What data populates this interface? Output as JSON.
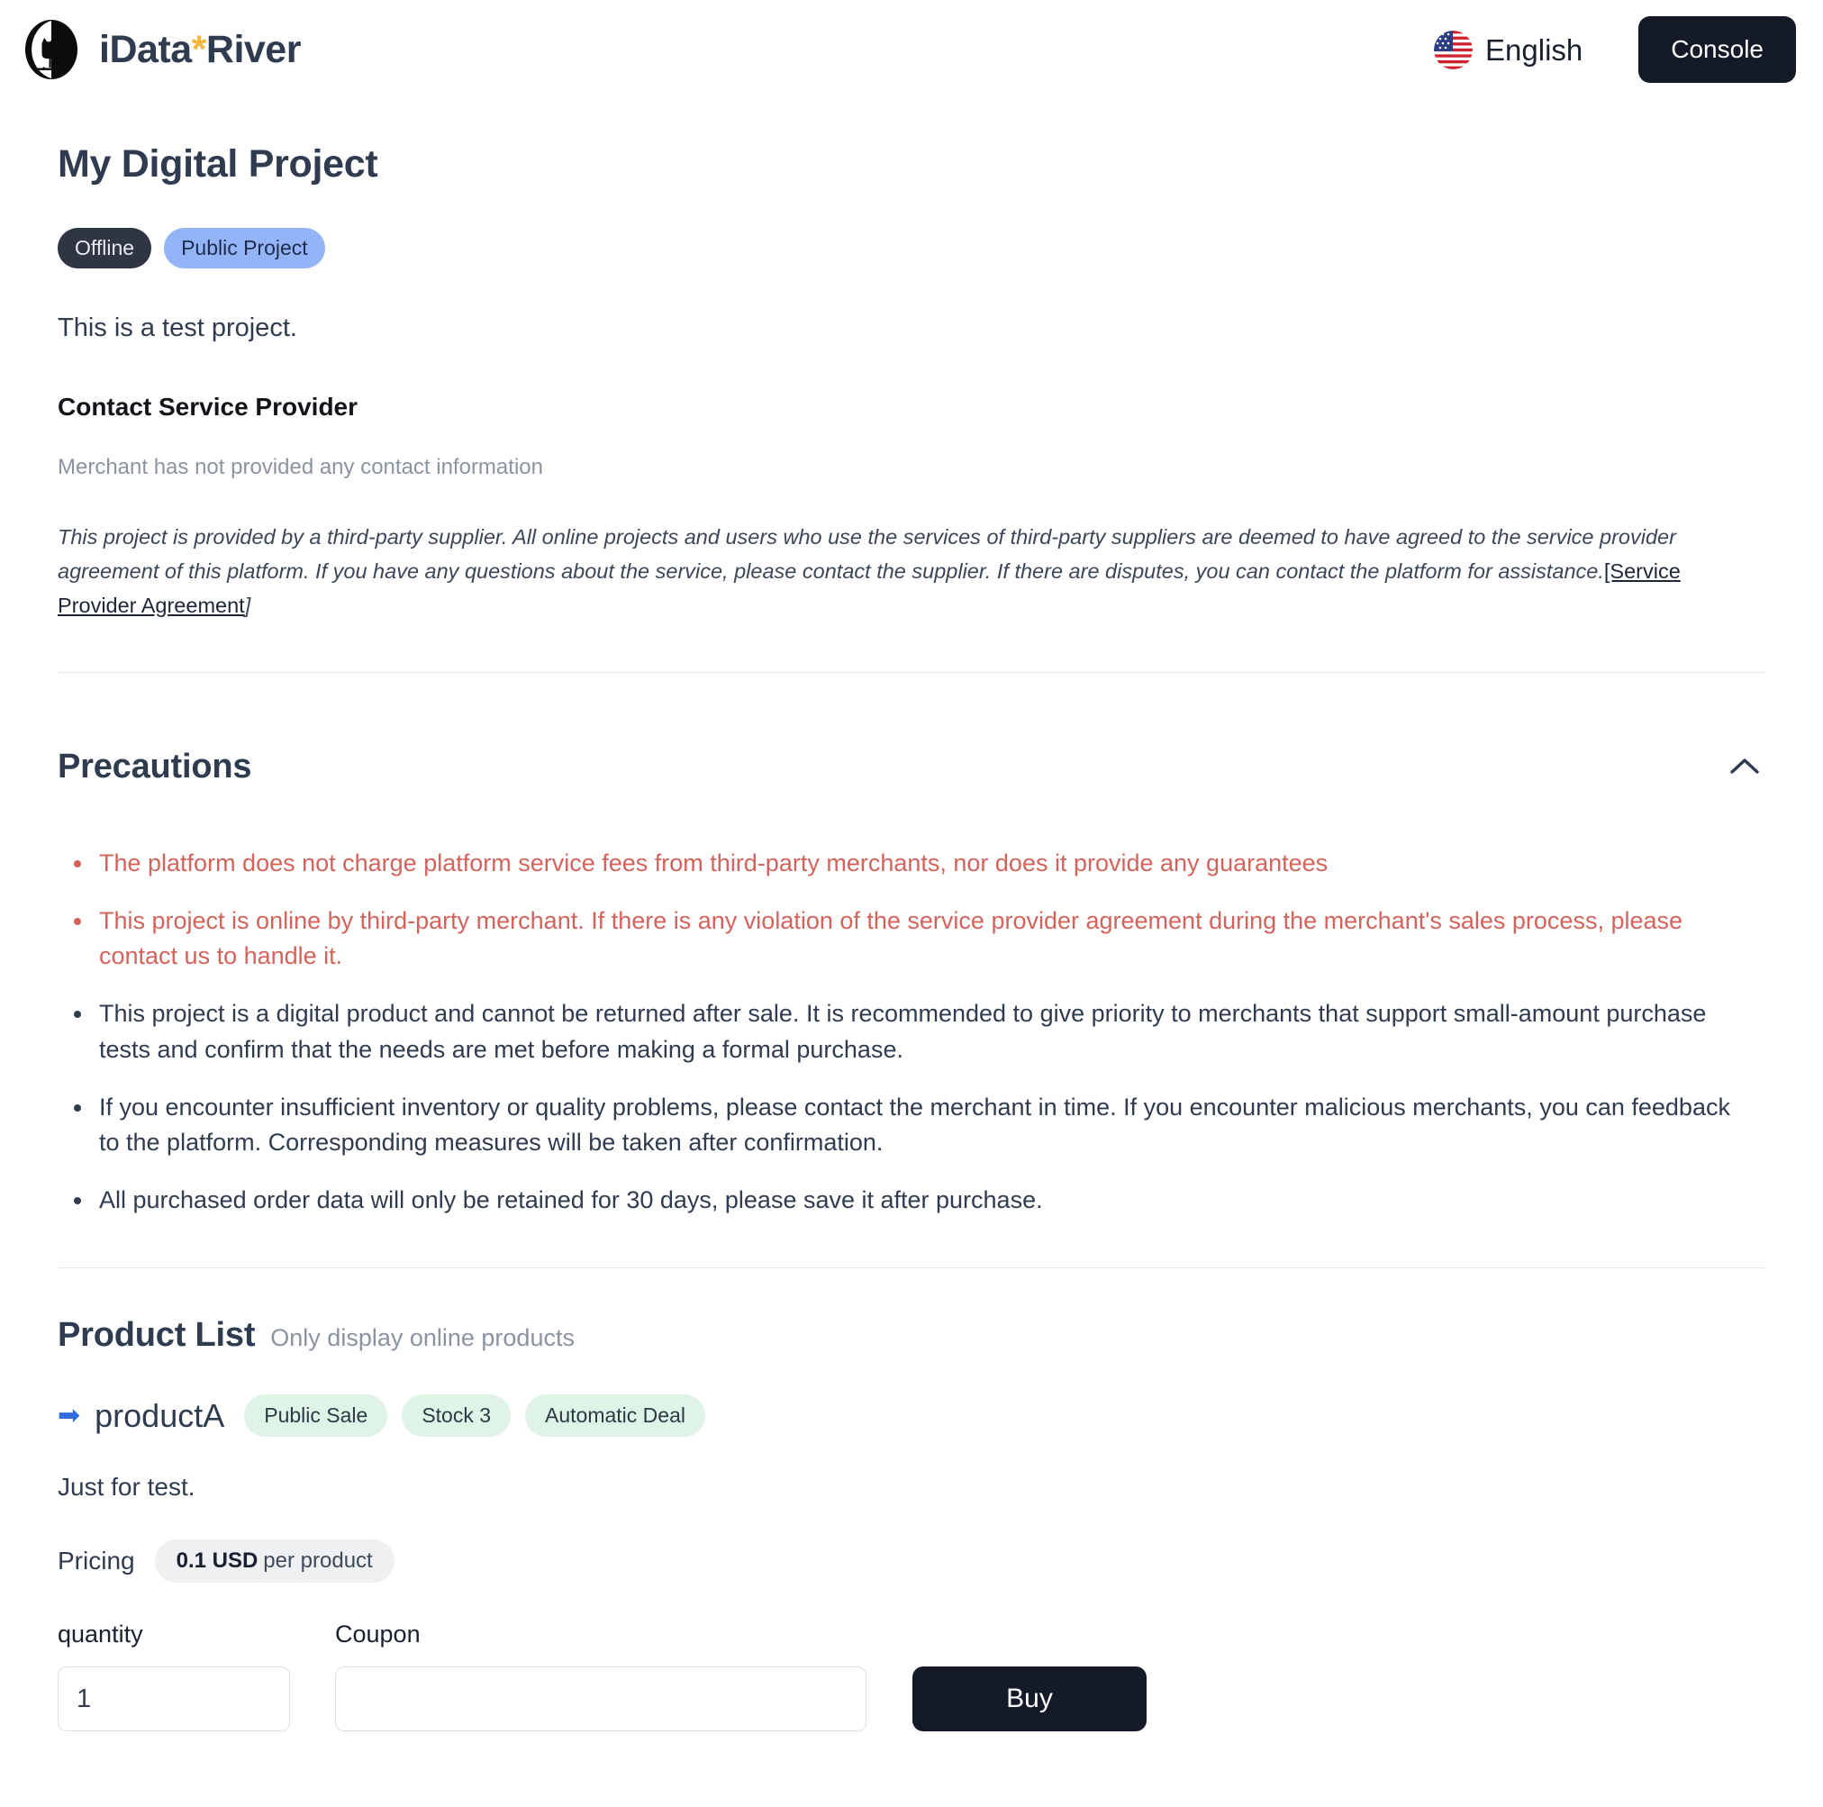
{
  "header": {
    "brand_prefix": "iData",
    "brand_star": "*",
    "brand_suffix": "River",
    "logo_icon": "cat-in-circle-logo",
    "flag_icon": "us-flag-icon",
    "language_label": "English",
    "console_label": "Console"
  },
  "project": {
    "title": "My Digital Project",
    "badges": [
      {
        "label": "Offline",
        "style": "dark"
      },
      {
        "label": "Public Project",
        "style": "blue"
      }
    ],
    "description": "This is a test project.",
    "contact_heading": "Contact Service Provider",
    "contact_note": "Merchant has not provided any contact information",
    "disclaimer_text": "This project is provided by a third-party supplier. All online projects and users who use the services of third-party suppliers are deemed to have agreed to the service provider agreement of this platform. If you have any questions about the service, please contact the supplier. If there are disputes, you can contact the platform for assistance.",
    "disclaimer_link": "[Service Provider Agreement",
    "disclaimer_link_tail": "]"
  },
  "precautions": {
    "title": "Precautions",
    "toggle_icon": "chevron-up-icon",
    "items": [
      {
        "text": "The platform does not charge platform service fees from third-party merchants, nor does it provide any guarantees",
        "warn": true
      },
      {
        "text": "This project is online by third-party merchant. If there is any violation of the service provider agreement during the merchant's sales process, please contact us to handle it.",
        "warn": true
      },
      {
        "text": "This project is a digital product and cannot be returned after sale. It is recommended to give priority to merchants that support small-amount purchase tests and confirm that the needs are met before making a formal purchase.",
        "warn": false
      },
      {
        "text": "If you encounter insufficient inventory or quality problems, please contact the merchant in time. If you encounter malicious merchants, you can feedback to the platform. Corresponding measures will be taken after confirmation.",
        "warn": false
      },
      {
        "text": "All purchased order data will only be retained for 30 days, please save it after purchase.",
        "warn": false
      }
    ]
  },
  "product_list": {
    "title": "Product List",
    "subtitle": "Only display online products",
    "product": {
      "arrow_icon": "➡",
      "name": "productA",
      "tags": [
        "Public Sale",
        "Stock 3",
        "Automatic Deal"
      ],
      "description": "Just for test.",
      "pricing_label": "Pricing",
      "price_amount": "0.1 USD",
      "price_unit": "per product",
      "quantity_label": "quantity",
      "quantity_value": "1",
      "quantity_placeholder": "",
      "coupon_label": "Coupon",
      "coupon_value": "",
      "coupon_placeholder": "",
      "buy_label": "Buy"
    }
  },
  "colors": {
    "accent_dark": "#141a28",
    "brand_star": "#f5b73d",
    "badge_blue": "#93b4f7",
    "tag_green": "#dff3e7",
    "warn_red": "#d4635c",
    "heading_slate": "#2f3c50"
  }
}
